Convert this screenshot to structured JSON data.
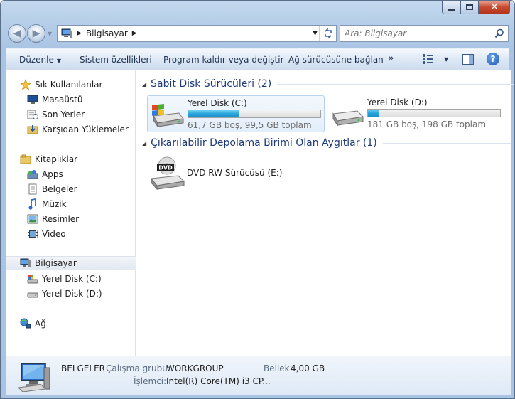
{
  "address": {
    "crumb": "Bilgisayar"
  },
  "search": {
    "placeholder": "Ara: Bilgisayar"
  },
  "toolbar": {
    "organize": "Düzenle",
    "system_properties": "Sistem özellikleri",
    "uninstall": "Program kaldır veya değiştir",
    "map_drive": "Ağ sürücüsüne bağlan",
    "more": "»"
  },
  "sidebar": {
    "favorites": "Sık Kullanılanlar",
    "favorites_items": [
      "Masaüstü",
      "Son Yerler",
      "Karşıdan Yüklemeler"
    ],
    "libraries": "Kitaplıklar",
    "library_items": [
      "Apps",
      "Belgeler",
      "Müzik",
      "Resimler",
      "Video"
    ],
    "computer": "Bilgisayar",
    "computer_items": [
      "Yerel Disk (C:)",
      "Yerel Disk (D:)"
    ],
    "network": "Ağ"
  },
  "groups": {
    "hdd_header": "Sabit Disk Sürücüleri (2)",
    "removable_header": "Çıkarılabilir Depolama Birimi Olan Aygıtlar (1)"
  },
  "drives": [
    {
      "name": "Yerel Disk (C:)",
      "info": "61,7 GB boş, 99,5 GB toplam",
      "used_fraction": 0.38
    },
    {
      "name": "Yerel Disk (D:)",
      "info": "181 GB boş, 198 GB toplam",
      "used_fraction": 0.086
    }
  ],
  "dvd": {
    "name": "DVD RW Sürücüsü (E:)",
    "label": "DVD"
  },
  "details": {
    "name": "BELGELER",
    "workgroup_label": "Çalışma grubu:",
    "workgroup": "WORKGROUP",
    "memory_label": "Bellek:",
    "memory": "4,00 GB",
    "cpu_label": "İşlemci:",
    "cpu": "Intel(R) Core(TM) i3 CP..."
  },
  "colors": {
    "accent": "#26a0da",
    "header_text": "#1e3a78"
  }
}
